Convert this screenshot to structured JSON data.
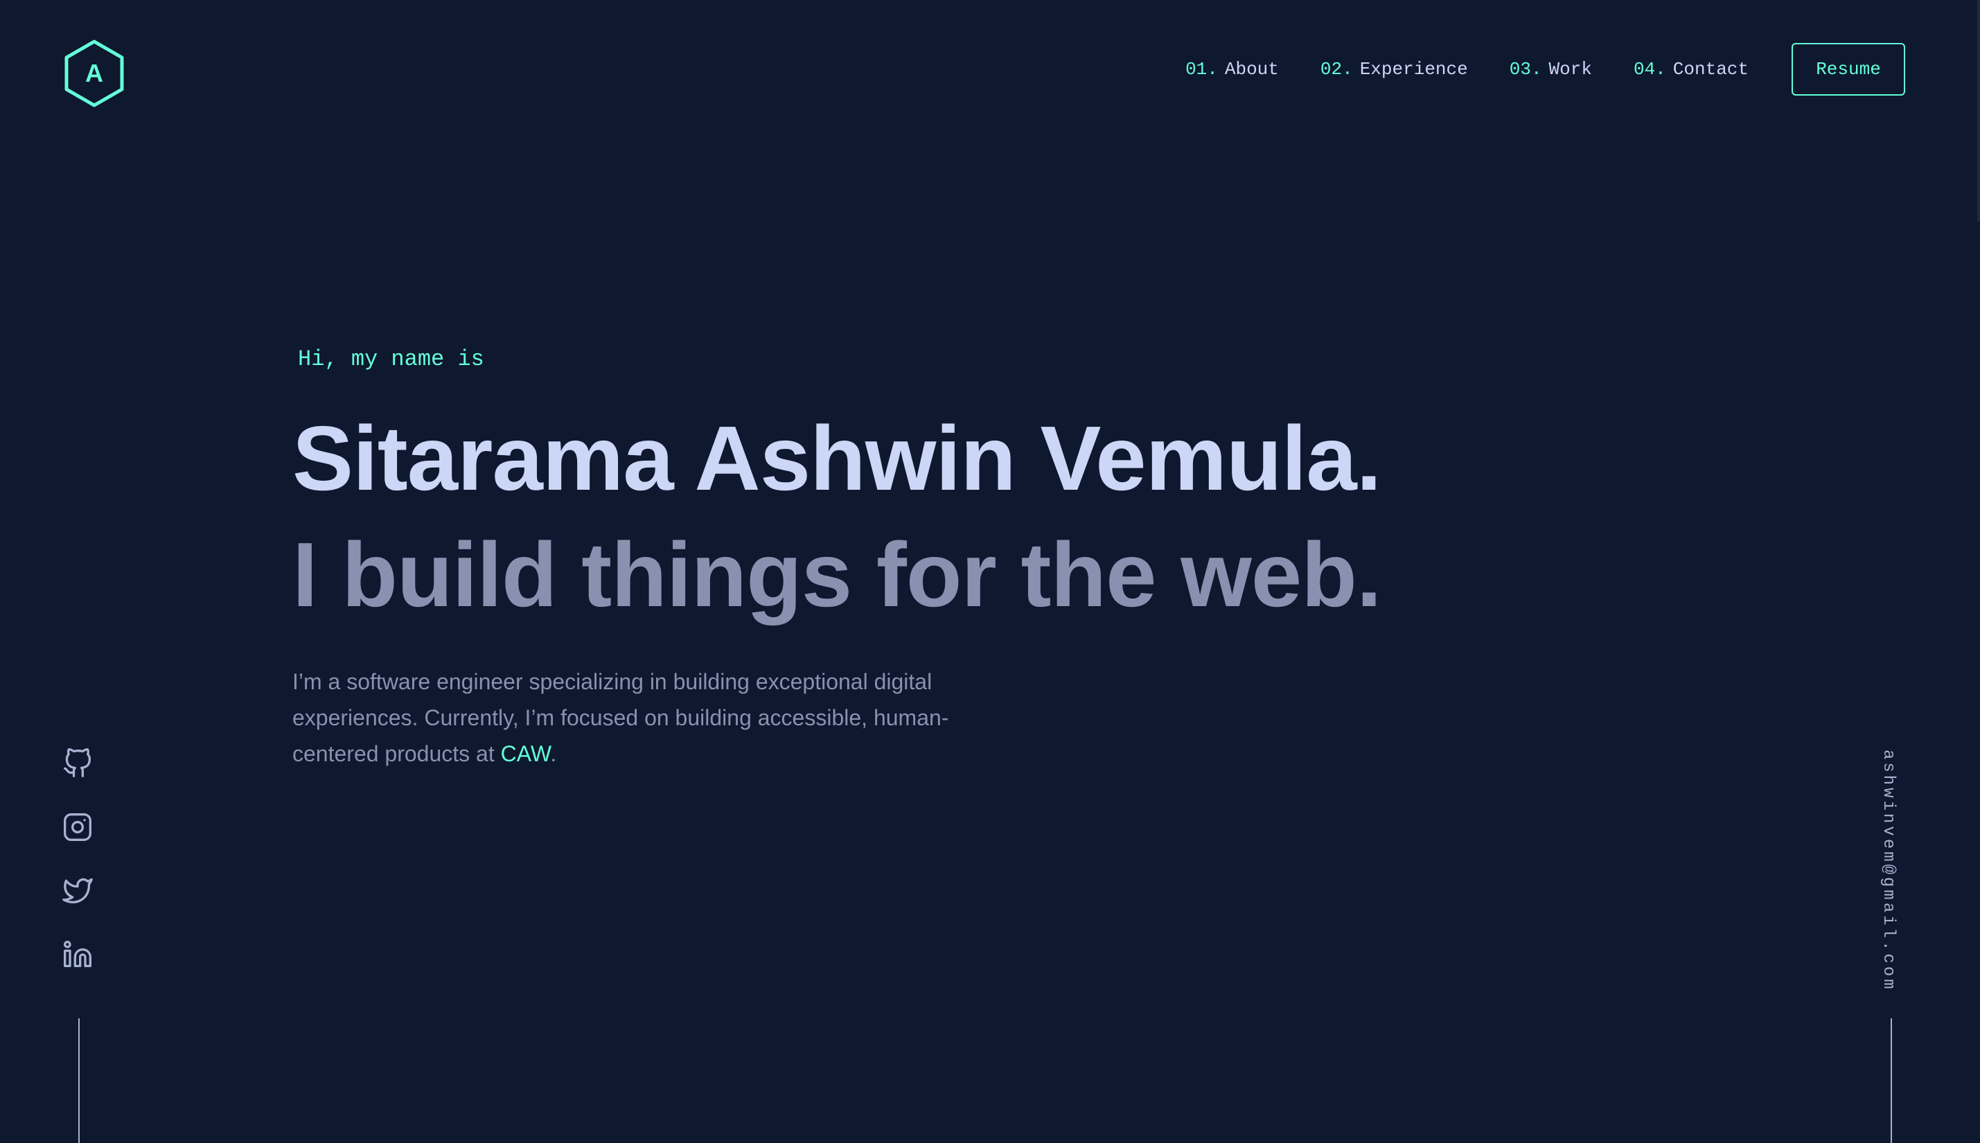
{
  "brand": {
    "logo_letter": "A",
    "accent_color": "#64ffda",
    "background_color": "#0e182e"
  },
  "nav": {
    "items": [
      {
        "number": "01.",
        "label": "About"
      },
      {
        "number": "02.",
        "label": "Experience"
      },
      {
        "number": "03.",
        "label": "Work"
      },
      {
        "number": "04.",
        "label": "Contact"
      }
    ],
    "resume_label": "Resume"
  },
  "hero": {
    "greeting": "Hi, my name is",
    "name": "Sitarama Ashwin Vemula.",
    "tagline": "I build things for the web.",
    "bio_text": "I’m a software engineer specializing in building exceptional digital experiences. Currently, I’m focused on building accessible, human-centered products at ",
    "bio_link": "CAW",
    "bio_end": "."
  },
  "socials": [
    {
      "icon": "github-icon"
    },
    {
      "icon": "instagram-icon"
    },
    {
      "icon": "twitter-icon"
    },
    {
      "icon": "linkedin-icon"
    }
  ],
  "email": "ashwinvem@gmail.com"
}
